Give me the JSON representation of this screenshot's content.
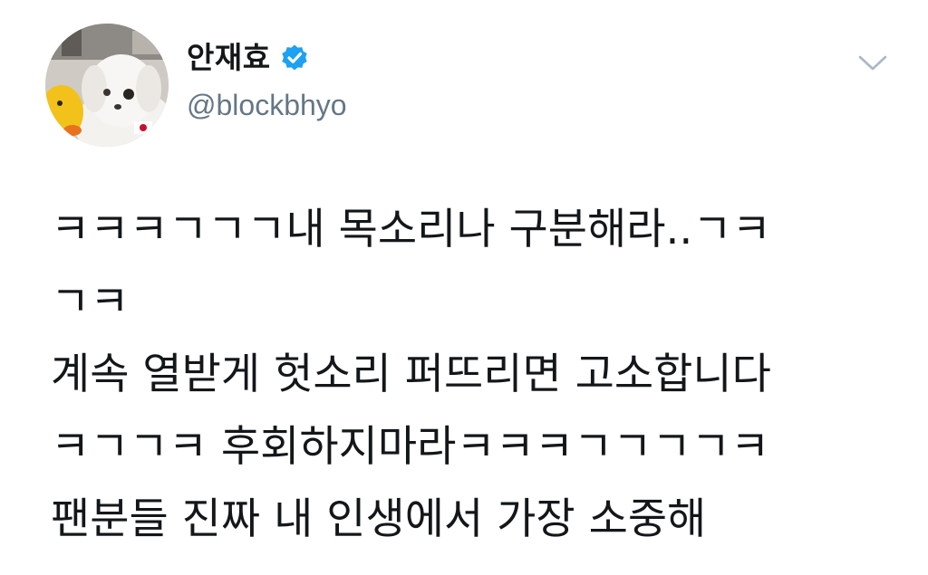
{
  "tweet": {
    "author": {
      "display_name": "안재효",
      "handle": "@blockbhyo",
      "verified": true,
      "avatar": "avatar-icon"
    },
    "menu_icon": "chevron-down-icon",
    "text_lines": [
      "ㅋㅋㅋㄱㄱㄱ내 목소리나 구분해라..ㄱㅋ",
      "ㄱㅋ",
      "계속 열받게 헛소리 퍼뜨리면 고소합니다",
      "ㅋㄱㄱㅋ 후회하지마라ㅋㅋㅋㄱㄱㄱㄱㅋ",
      "팬분들 진짜 내 인생에서 가장 소중해"
    ]
  },
  "colors": {
    "text": "#14171a",
    "handle": "#657786",
    "verified": "#1da1f2",
    "caret": "#aab8c2",
    "background": "#ffffff"
  }
}
